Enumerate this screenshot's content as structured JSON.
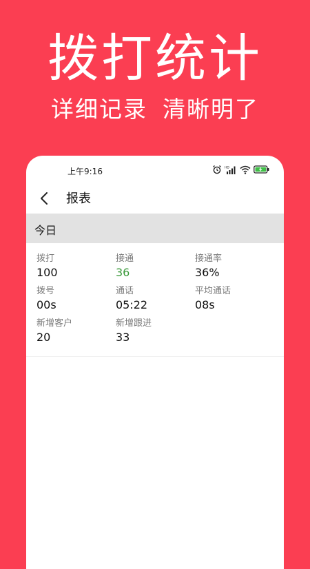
{
  "promo": {
    "headline": "拨打统计",
    "subline_left": "详细记录",
    "subline_right": "清晰明了"
  },
  "statusbar": {
    "time": "上午9:16",
    "icons": [
      "alarm-icon",
      "hd-signal-icon",
      "wifi-icon",
      "battery-charging-icon"
    ]
  },
  "navbar": {
    "back_icon": "chevron-left-icon",
    "title": "报表"
  },
  "section": {
    "title": "今日"
  },
  "stats": [
    [
      {
        "label": "拨打",
        "value": "100"
      },
      {
        "label": "接通",
        "value": "36"
      },
      {
        "label": "接通率",
        "value": "36%"
      }
    ],
    [
      {
        "label": "拨号",
        "value": "00s"
      },
      {
        "label": "通话",
        "value": "05:22"
      },
      {
        "label": "平均通话",
        "value": "08s"
      }
    ],
    [
      {
        "label": "新增客户",
        "value": "20"
      },
      {
        "label": "新增跟进",
        "value": "33"
      }
    ]
  ],
  "colors": {
    "brand_red": "#fb3e52",
    "connected_green": "#3c9a3c",
    "section_gray": "#e2e2e2"
  }
}
